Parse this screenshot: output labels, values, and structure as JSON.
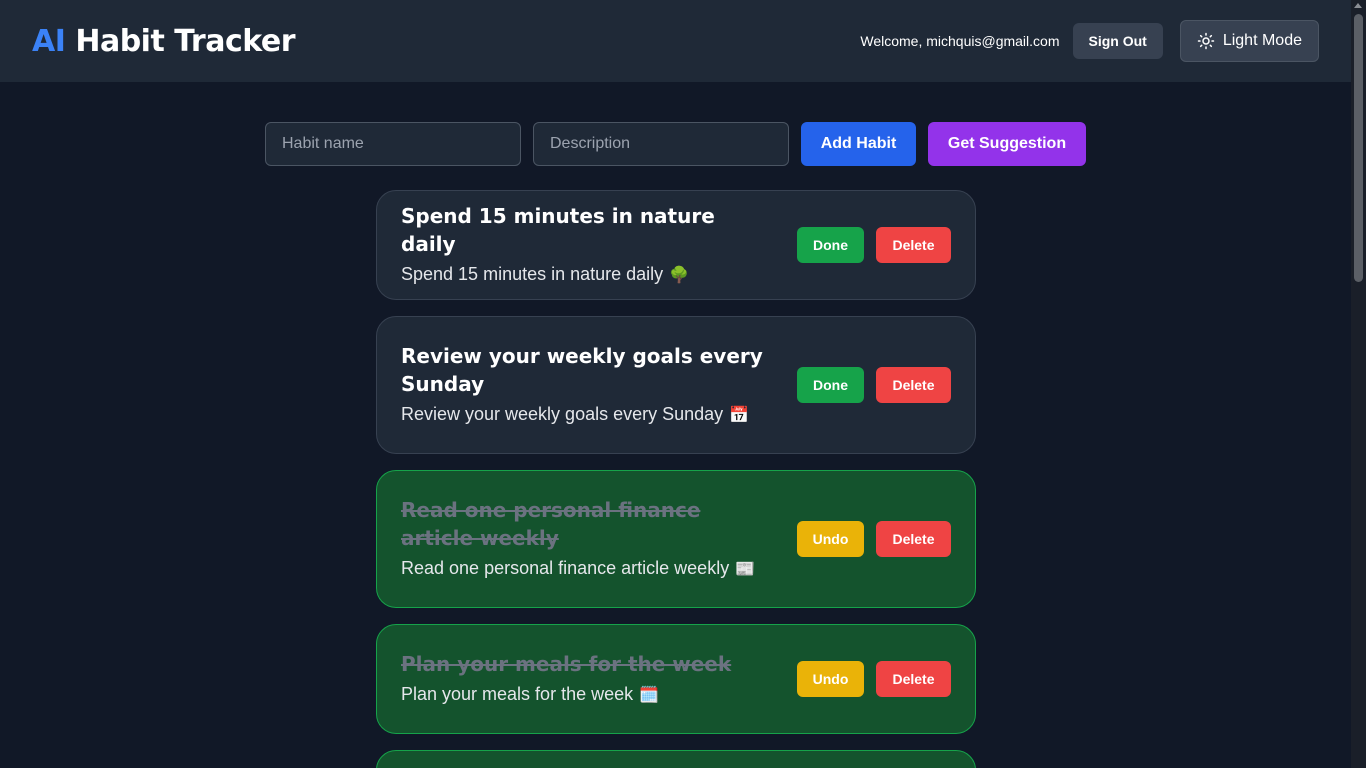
{
  "header": {
    "logo_ai": "AI",
    "logo_rest": "Habit Tracker",
    "welcome": "Welcome, michquis@gmail.com",
    "signout_label": "Sign Out",
    "theme_label": "Light Mode",
    "theme_icon": "sun-icon"
  },
  "form": {
    "name_placeholder": "Habit name",
    "desc_placeholder": "Description",
    "add_label": "Add Habit",
    "suggest_label": "Get Suggestion"
  },
  "habits": [
    {
      "title": "Spend 15 minutes in nature daily",
      "description": "Spend 15 minutes in nature daily",
      "emoji": "🌳",
      "completed": false,
      "action_label": "Done",
      "delete_label": "Delete"
    },
    {
      "title": "Review your weekly goals every Sunday",
      "description": "Review your weekly goals every Sunday",
      "emoji": "📅",
      "completed": false,
      "action_label": "Done",
      "delete_label": "Delete"
    },
    {
      "title": "Read one personal finance article weekly",
      "description": "Read one personal finance article weekly",
      "emoji": "📰",
      "completed": true,
      "action_label": "Undo",
      "delete_label": "Delete"
    },
    {
      "title": "Plan your meals for the week",
      "description": "Plan your meals for the week",
      "emoji": "🗓️",
      "completed": true,
      "action_label": "Undo",
      "delete_label": "Delete"
    }
  ],
  "colors": {
    "background": "#111827",
    "header": "#1f2937",
    "accent_blue": "#2563eb",
    "accent_purple": "#9333ea",
    "done_green": "#16a34a",
    "undo_yellow": "#eab308",
    "delete_red": "#ef4444",
    "completed_card": "#14532d"
  }
}
